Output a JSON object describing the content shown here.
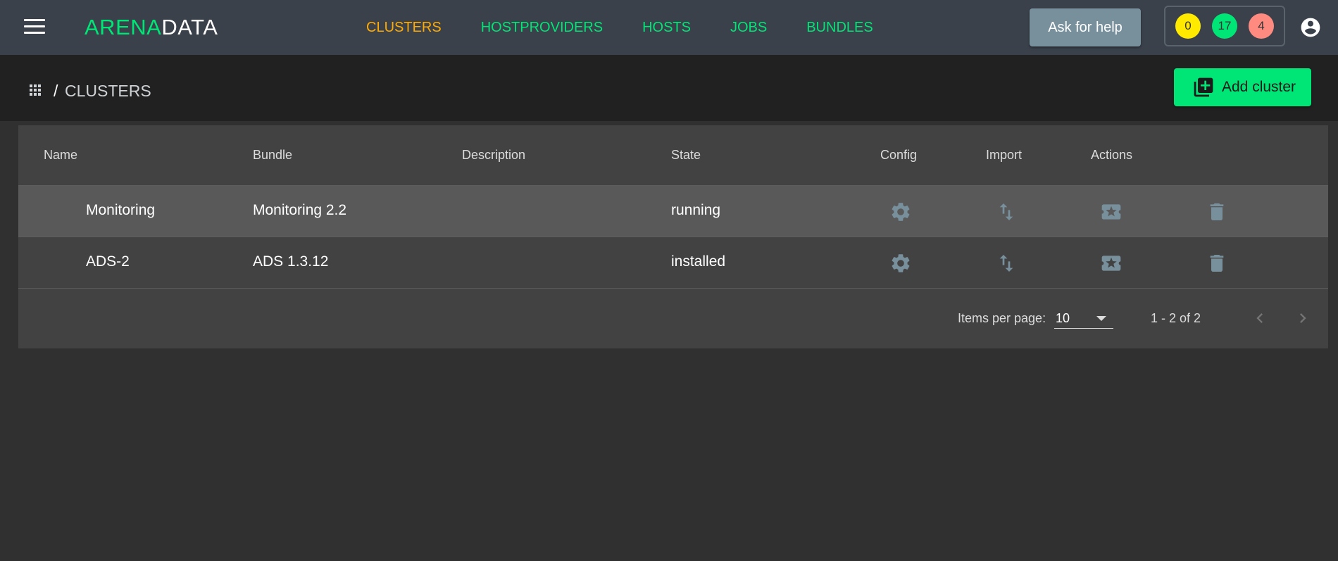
{
  "topbar": {
    "logo_part1": "ARENA",
    "logo_part2": "DATA",
    "nav": [
      "CLUSTERS",
      "HOSTPROVIDERS",
      "HOSTS",
      "JOBS",
      "BUNDLES"
    ],
    "help_label": "Ask for help",
    "badges": {
      "yellow": "0",
      "green": "17",
      "red": "4"
    }
  },
  "breadcrumb": {
    "separator": "/",
    "title": "CLUSTERS"
  },
  "add_button_label": "Add cluster",
  "table": {
    "columns": [
      "Name",
      "Bundle",
      "Description",
      "State",
      "Config",
      "Import",
      "Actions"
    ],
    "rows": [
      {
        "name": "Monitoring",
        "bundle": "Monitoring 2.2",
        "description": "",
        "state": "running"
      },
      {
        "name": "ADS-2",
        "bundle": "ADS 1.3.12",
        "description": "",
        "state": "installed"
      }
    ]
  },
  "paginator": {
    "items_per_page_label": "Items per page:",
    "page_size": "10",
    "range": "1 - 2 of 2"
  },
  "colors": {
    "accent": "#00e676",
    "active_nav": "#ffab00",
    "topbar": "#3a414b",
    "icon": "#78909c"
  }
}
